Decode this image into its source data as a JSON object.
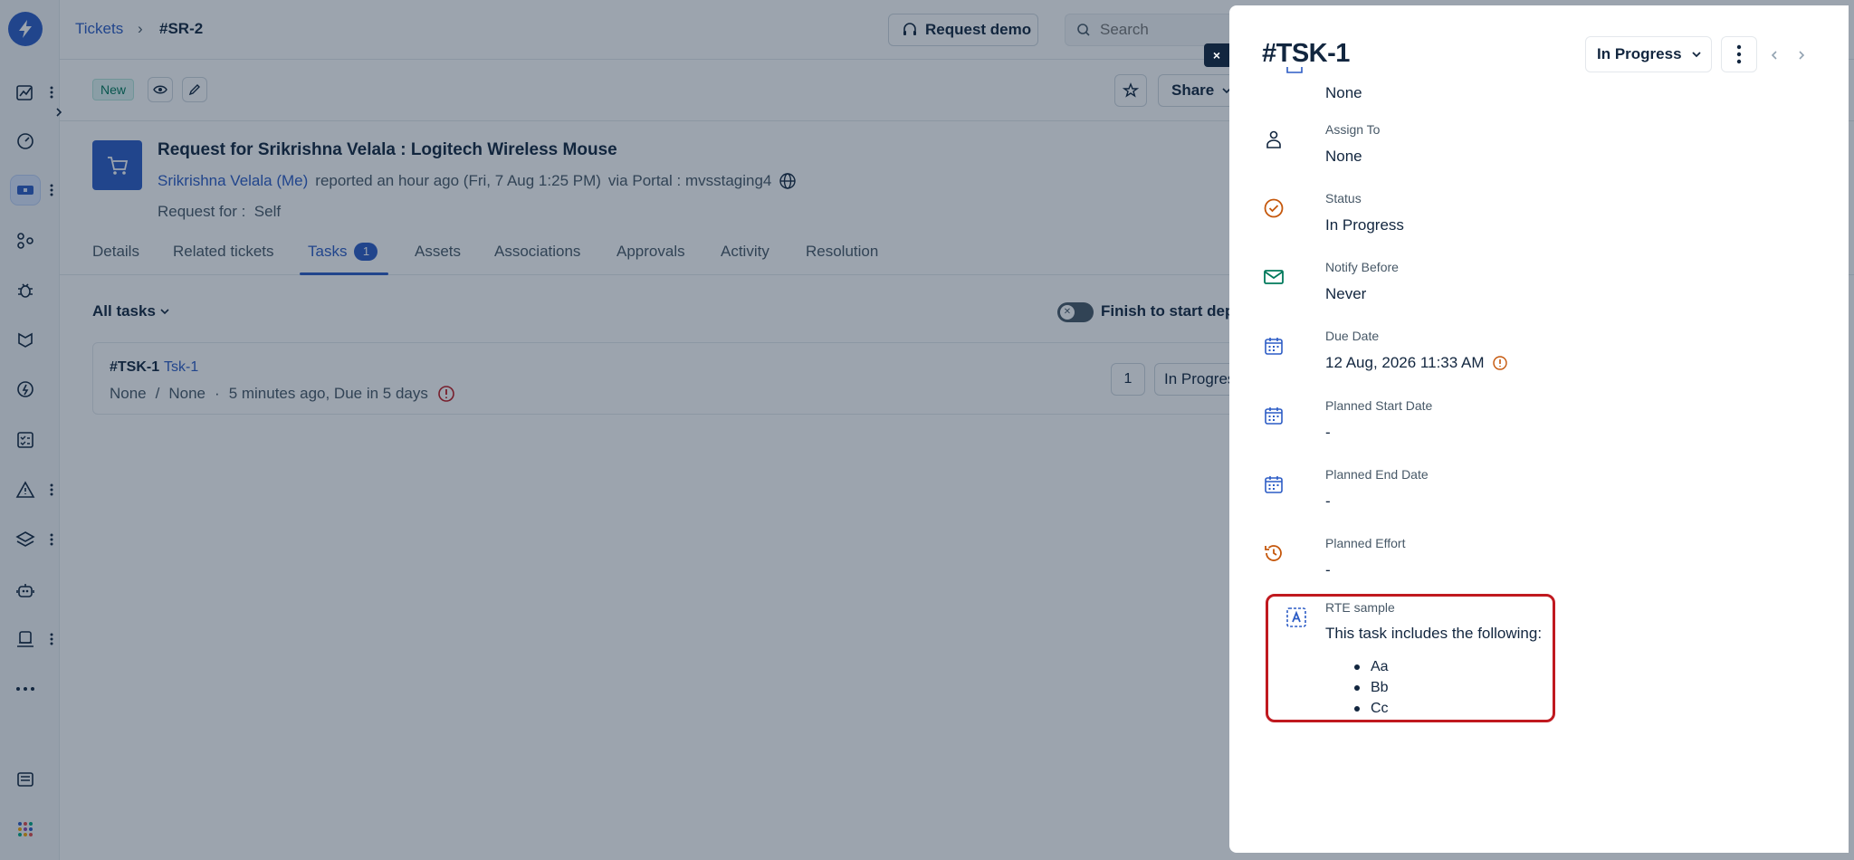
{
  "topbar": {
    "breadcrumb_root": "Tickets",
    "breadcrumb_sep": "›",
    "breadcrumb_current": "#SR-2",
    "request_demo_label": "Request demo",
    "search_placeholder": "Search"
  },
  "subbar": {
    "status_badge": "New",
    "share_label": "Share"
  },
  "ticket": {
    "title": "Request for Srikrishna Velala : Logitech Wireless Mouse",
    "requester": "Srikrishna Velala (Me)",
    "reported": "reported an hour ago (Fri, 7 Aug 1:25 PM)",
    "via": "via Portal : mvsstaging4",
    "request_for_label": "Request for :",
    "request_for_value": "Self"
  },
  "tabs": [
    {
      "label": "Details"
    },
    {
      "label": "Related tickets"
    },
    {
      "label": "Tasks",
      "count": "1"
    },
    {
      "label": "Assets"
    },
    {
      "label": "Associations"
    },
    {
      "label": "Approvals"
    },
    {
      "label": "Activity"
    },
    {
      "label": "Resolution"
    }
  ],
  "tasks_panel": {
    "filter_label": "All tasks",
    "toggle_label": "Finish to start dep",
    "task": {
      "id": "#TSK-1",
      "name": "Tsk-1",
      "group": "None",
      "separator": "/",
      "agent": "None",
      "dot": "·",
      "time": "5 minutes ago, Due in 5 days",
      "number": "1",
      "status": "In Progress"
    }
  },
  "drawer": {
    "close_label": "×",
    "title": "#TSK-1",
    "status_value": "In Progress",
    "top_cut_value": "None",
    "fields": [
      {
        "label": "Assign To",
        "value": "None"
      },
      {
        "label": "Status",
        "value": "In Progress"
      },
      {
        "label": "Notify Before",
        "value": "Never"
      },
      {
        "label": "Due Date",
        "value": "12 Aug, 2026 11:33 AM"
      },
      {
        "label": "Planned Start Date",
        "value": "-"
      },
      {
        "label": "Planned End Date",
        "value": "-"
      },
      {
        "label": "Planned Effort",
        "value": "-"
      }
    ],
    "rte": {
      "label": "RTE sample",
      "text": "This task includes the following:",
      "items": [
        "Aa",
        "Bb",
        "Cc"
      ]
    }
  },
  "colors": {
    "brand_blue": "#2c5cc5",
    "status_orange": "#c5570b",
    "notify_green": "#00795b",
    "highlight_red": "#c0191f"
  }
}
